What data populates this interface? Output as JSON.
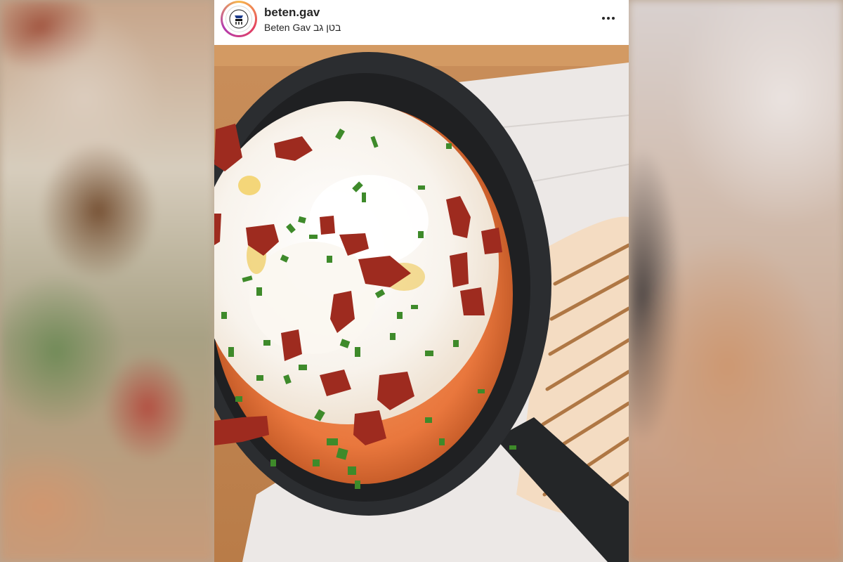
{
  "post": {
    "username": "beten.gav",
    "display_name": "Beten Gav בטן גב",
    "more_icon": "more-horizontal-icon",
    "avatar_icon": "brand-logo-icon"
  },
  "photo": {
    "subject": "shakshuka-skillet-photo"
  },
  "colors": {
    "text": "#262626",
    "avatar_ring": "#e4405f",
    "background": "#ffffff"
  }
}
